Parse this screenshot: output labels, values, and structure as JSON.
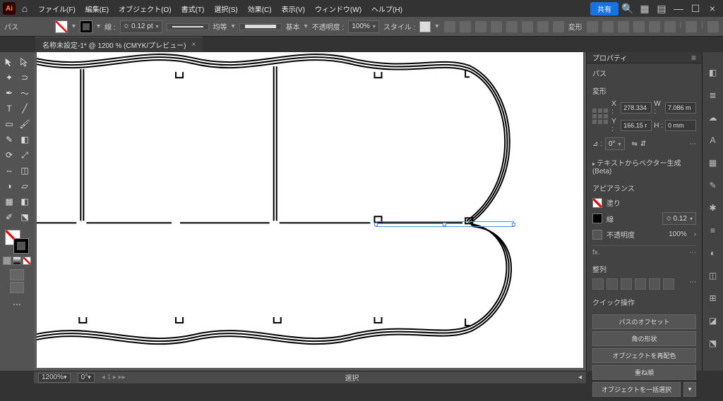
{
  "menubar": {
    "items": [
      "ファイル(F)",
      "編集(E)",
      "オブジェクト(O)",
      "書式(T)",
      "選択(S)",
      "効果(C)",
      "表示(V)",
      "ウィンドウ(W)",
      "ヘルプ(H)"
    ],
    "share": "共有"
  },
  "controlbar": {
    "context": "パス",
    "stroke_label": "線 :",
    "stroke_width": "0.12 pt",
    "profile": "均等",
    "brush": "基本",
    "opacity_label": "不透明度 :",
    "opacity": "100%",
    "style_label": "スタイル :",
    "transform": "変形"
  },
  "doc_tab": "名称未設定-1* @ 1200 % (CMYK/プレビュー)",
  "properties": {
    "title": "プロパティ",
    "sel_type": "パス",
    "transform": {
      "title": "変形",
      "x_label": "X :",
      "x": "278.334",
      "y_label": "Y :",
      "y": "166.15 r",
      "w_label": "W :",
      "w": "7.086 m",
      "h_label": "H :",
      "h": "0 mm",
      "angle_label": "⊿ :",
      "angle": "0°"
    },
    "vecgen": "テキストからベクター生成 (Beta)",
    "appearance": {
      "title": "アピアランス",
      "fill": "塗り",
      "stroke": "線",
      "stroke_val": "0.12",
      "opacity": "不透明度",
      "opacity_val": "100%",
      "fx": "fx."
    },
    "align": {
      "title": "整列"
    },
    "quick": {
      "title": "クイック操作",
      "offset": "パスのオフセット",
      "corner": "角の形状",
      "recolor": "オブジェクトを再配色",
      "arrange": "重ね順",
      "select_all": "オブジェクトを一括選択"
    }
  },
  "statusbar": {
    "zoom": "1200%",
    "rotate": "0°",
    "sel": "選択"
  }
}
